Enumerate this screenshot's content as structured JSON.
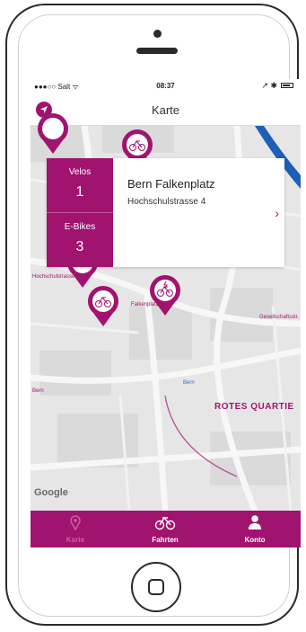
{
  "status_bar": {
    "carrier": "●●●○○ Salt ᯤ",
    "time": "08:37",
    "indicators": "↗ ✱"
  },
  "nav": {
    "title": "Karte",
    "locate_icon": "location-arrow-icon"
  },
  "map": {
    "street_label_1": "Hochschulstrasse",
    "street_label_2": "Falkenplatz",
    "street_label_3": "Bern",
    "street_label_4": "Gesellschaftsstr.",
    "district_label": "ROTES QUARTIE",
    "station_label": "Bern",
    "attribution": "Google",
    "accent_color": "#a0136f",
    "pins": [
      {
        "type": "bike-pin-icon"
      },
      {
        "type": "bike-pin-icon"
      },
      {
        "type": "ebike-pin-icon"
      },
      {
        "type": "bike-pin-icon"
      },
      {
        "type": "bike-pin-icon"
      }
    ]
  },
  "card": {
    "velos_label": "Velos",
    "velos_count": "1",
    "ebikes_label": "E-Bikes",
    "ebikes_count": "3",
    "station_name": "Bern Falkenplatz",
    "address": "Hochschulstrasse 4",
    "chevron": "›"
  },
  "tabs": [
    {
      "label": "Karte",
      "icon": "map-pin-icon",
      "active": true
    },
    {
      "label": "Fahrten",
      "icon": "bike-icon",
      "active": false
    },
    {
      "label": "Konto",
      "icon": "user-icon",
      "active": false
    }
  ]
}
